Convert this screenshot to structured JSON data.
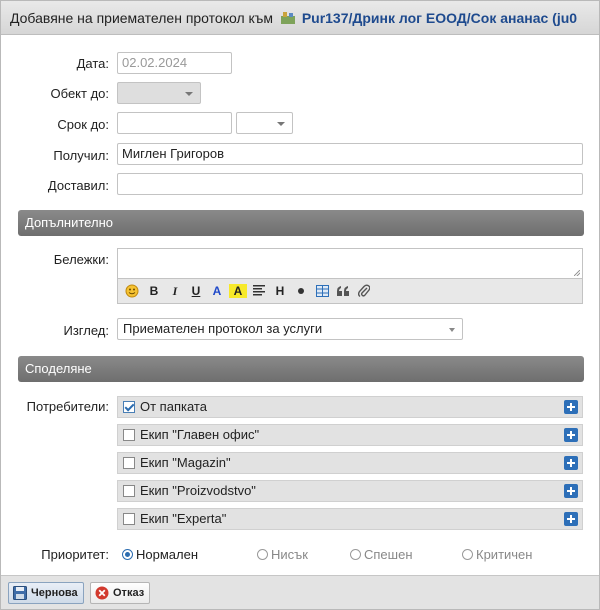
{
  "title": {
    "prefix": "Добавяне на приемателен протокол към",
    "project": "Pur137/Дринк лог ЕООД/Сок ананас (ju0"
  },
  "form": {
    "date_label": "Дата:",
    "date_value": "02.02.2024",
    "object_label": "Обект до:",
    "due_label": "Срок до:",
    "recipient_label": "Получил:",
    "recipient_value": "Миглен Григоров",
    "deliverer_label": "Доставил:",
    "deliverer_value": ""
  },
  "section_extra": "Допълнително",
  "notes": {
    "label": "Бележки:",
    "value": "",
    "toolbar": {
      "bold": "B",
      "italic": "I",
      "underline": "U",
      "font_color": "A",
      "highlight": "A",
      "heading": "H"
    }
  },
  "view": {
    "label": "Изглед:",
    "value": "Приемателен протокол за услуги"
  },
  "section_share": "Споделяне",
  "users": {
    "label": "Потребители:",
    "items": [
      {
        "name": "От папката",
        "checked": true
      },
      {
        "name": "Екип \"Главен офис\"",
        "checked": false
      },
      {
        "name": "Екип \"Magazin\"",
        "checked": false
      },
      {
        "name": "Екип \"Proizvodstvo\"",
        "checked": false
      },
      {
        "name": "Екип \"Experta\"",
        "checked": false
      }
    ]
  },
  "priority": {
    "label": "Приоритет:",
    "options": [
      "Нормален",
      "Нисък",
      "Спешен",
      "Критичен"
    ],
    "selected": "Нормален"
  },
  "footer": {
    "draft_label": "Чернова",
    "cancel_label": "Отказ"
  },
  "colors": {
    "accent": "#2b6cb0",
    "project_link": "#1e4a8e",
    "section_bg": "#7c7c7c"
  }
}
